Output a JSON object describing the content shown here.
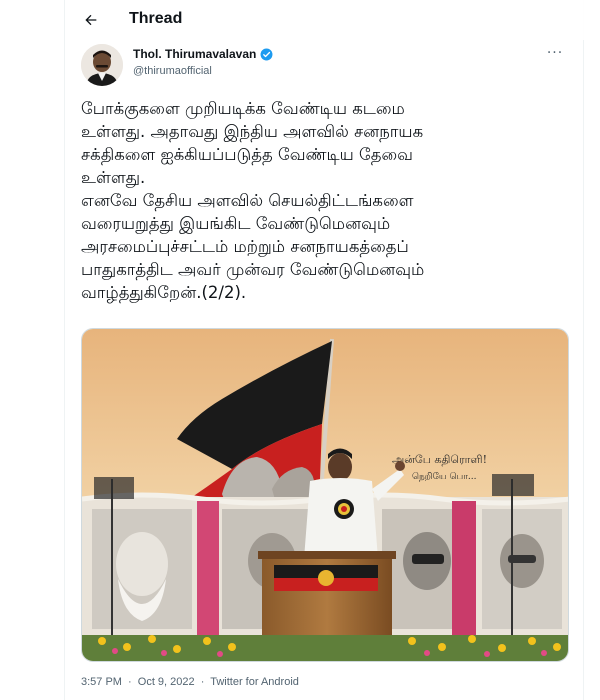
{
  "header": {
    "title": "Thread"
  },
  "author": {
    "name": "Thol. Thirumavalavan",
    "handle": "@thirumaofficial"
  },
  "tweet": {
    "text": "போக்குகளை முறியடிக்க வேண்டிய கடமை\nஉள்ளது. அதாவது இந்திய அளவில் சனநாயக\nசக்திகளை ஐக்கியப்படுத்த வேண்டிய தேவை\nஉள்ளது.\nஎனவே தேசிய அளவில் செயல்திட்டங்களை\nவரையறுத்து இயங்கிட வேண்டுமெனவும்\nஅரசமைப்புச்சட்டம் மற்றும் சனநாயகத்தைப்\nபாதுகாத்திட அவர் முன்வர வேண்டுமெனவும்\nவாழ்த்துகிறேன்.(2/2)."
  },
  "media": {
    "banner_text_line1": "அன்பே கதிரொளி!",
    "banner_text_line2": "நெறியே பொ..."
  },
  "meta": {
    "time": "3:57 PM",
    "separator": "·",
    "date": "Oct 9, 2022",
    "source": "Twitter for Android"
  },
  "colors": {
    "text": "#0f1419",
    "secondary": "#536471",
    "verified": "#1d9bf0",
    "border": "#cfd9de",
    "flag_red": "#c8201f",
    "flag_black": "#1a1a1a"
  },
  "icons": {
    "back": "arrow-left-icon",
    "verified": "verified-badge-icon",
    "more": "more-horizontal-icon"
  }
}
